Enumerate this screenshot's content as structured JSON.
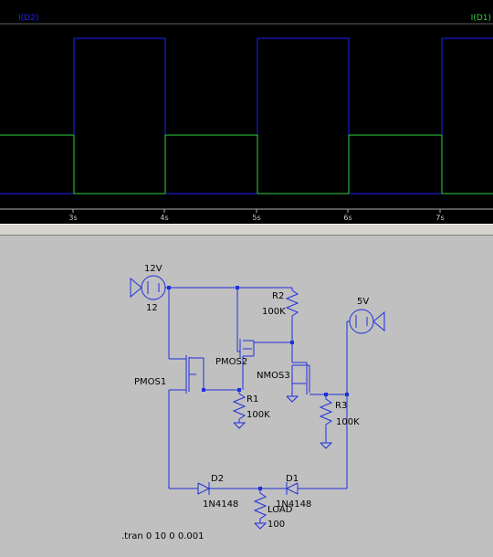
{
  "waveform": {
    "traces": [
      {
        "name": "I(D2)",
        "color": "#2020ff"
      },
      {
        "name": "I(D1)",
        "color": "#30d040"
      }
    ],
    "x_ticks": [
      "3s",
      "4s",
      "5s",
      "6s",
      "7s"
    ]
  },
  "schematic": {
    "supply_12v": {
      "name": "12V",
      "value": "12"
    },
    "supply_5v": {
      "name": "5V"
    },
    "components": {
      "r2": {
        "name": "R2",
        "value": "100K"
      },
      "r1": {
        "name": "R1",
        "value": "100K"
      },
      "r3": {
        "name": "R3",
        "value": "100K"
      },
      "pmos2": {
        "name": "PMOS2"
      },
      "pmos1": {
        "name": "PMOS1"
      },
      "nmos3": {
        "name": "NMOS3"
      },
      "d2": {
        "name": "D2",
        "value": "1N4148"
      },
      "d1": {
        "name": "D1",
        "value": "1N4148"
      },
      "load": {
        "name": "LOAD",
        "value": "100"
      }
    },
    "directive": ".tran 0 10 0 0.001"
  }
}
